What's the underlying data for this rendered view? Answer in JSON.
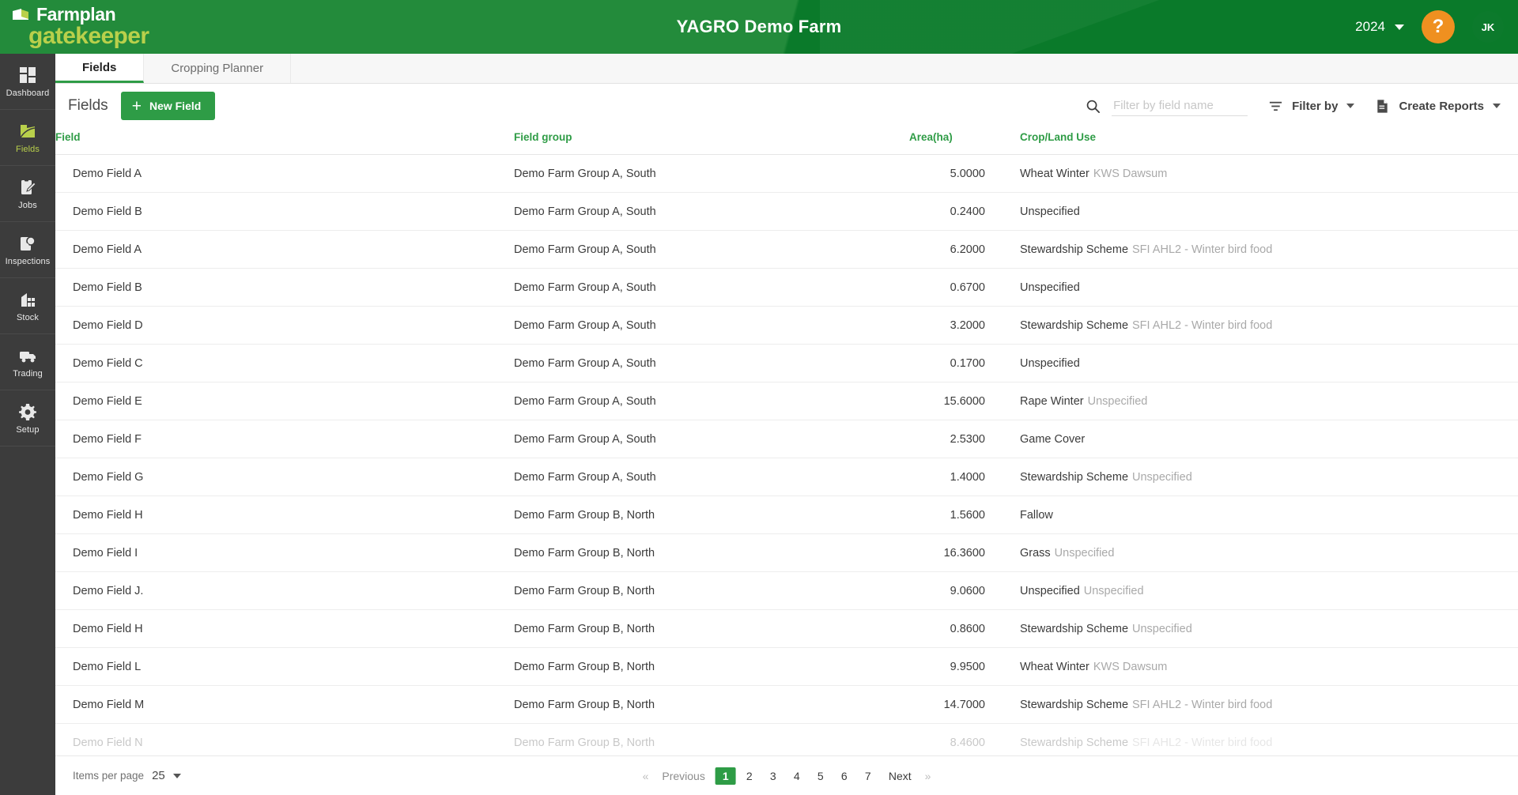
{
  "header": {
    "logo_primary": "Farmplan",
    "logo_secondary": "gatekeeper",
    "logo_mark_icon": "farmplan-leaf-icon",
    "farm_title": "YAGRO Demo Farm",
    "year": "2024",
    "year_caret_icon": "chevron-down-icon",
    "help_label": "?",
    "avatar_initials": "JK",
    "accent_green": "#1f8b38",
    "accent_orange": "#ef9020",
    "accent_lime": "#b9d04b"
  },
  "sidebar": {
    "items": [
      {
        "label": "Dashboard",
        "icon": "dashboard-grid-icon",
        "active": false
      },
      {
        "label": "Fields",
        "icon": "field-landscape-icon",
        "active": true
      },
      {
        "label": "Jobs",
        "icon": "clipboard-pencil-icon",
        "active": false
      },
      {
        "label": "Inspections",
        "icon": "magnifier-clipboard-icon",
        "active": false
      },
      {
        "label": "Stock",
        "icon": "warehouse-icon",
        "active": false
      },
      {
        "label": "Trading",
        "icon": "truck-icon",
        "active": false
      },
      {
        "label": "Setup",
        "icon": "gear-icon",
        "active": false
      }
    ]
  },
  "tabs": [
    {
      "label": "Fields",
      "active": true
    },
    {
      "label": "Cropping Planner",
      "active": false
    }
  ],
  "toolbar": {
    "page_title": "Fields",
    "new_field_label": "New Field",
    "new_field_plus": "+",
    "search_placeholder": "Filter by field name",
    "search_value": "",
    "search_icon": "search-icon",
    "filter_by_label": "Filter by",
    "filter_icon": "filter-funnel-icon",
    "create_reports_label": "Create Reports",
    "create_reports_icon": "document-icon"
  },
  "table": {
    "columns": [
      "Field",
      "Field group",
      "Area(ha)",
      "Crop/Land Use"
    ],
    "rows": [
      {
        "field": "Demo Field A",
        "group": "Demo Farm Group A, South",
        "area": "5.0000",
        "crop": "Wheat Winter",
        "variety": "KWS Dawsum"
      },
      {
        "field": "Demo Field B",
        "group": "Demo Farm Group A, South",
        "area": "0.2400",
        "crop": "Unspecified",
        "variety": ""
      },
      {
        "field": "Demo Field A",
        "group": "Demo Farm Group A, South",
        "area": "6.2000",
        "crop": "Stewardship Scheme",
        "variety": "SFI AHL2 - Winter bird food"
      },
      {
        "field": "Demo Field B",
        "group": "Demo Farm Group A, South",
        "area": "0.6700",
        "crop": "Unspecified",
        "variety": ""
      },
      {
        "field": "Demo Field D",
        "group": "Demo Farm Group A, South",
        "area": "3.2000",
        "crop": "Stewardship Scheme",
        "variety": "SFI AHL2 - Winter bird food"
      },
      {
        "field": "Demo Field C",
        "group": "Demo Farm Group A, South",
        "area": "0.1700",
        "crop": "Unspecified",
        "variety": ""
      },
      {
        "field": "Demo Field E",
        "group": "Demo Farm Group A, South",
        "area": "15.6000",
        "crop": "Rape Winter",
        "variety": "Unspecified"
      },
      {
        "field": "Demo Field F",
        "group": "Demo Farm Group A, South",
        "area": "2.5300",
        "crop": "Game Cover",
        "variety": ""
      },
      {
        "field": "Demo Field G",
        "group": "Demo Farm Group A, South",
        "area": "1.4000",
        "crop": "Stewardship Scheme",
        "variety": "Unspecified"
      },
      {
        "field": "Demo Field H",
        "group": "Demo Farm Group B, North",
        "area": "1.5600",
        "crop": "Fallow",
        "variety": ""
      },
      {
        "field": "Demo Field I",
        "group": "Demo Farm Group B, North",
        "area": "16.3600",
        "crop": "Grass",
        "variety": "Unspecified"
      },
      {
        "field": "Demo Field J.",
        "group": "Demo Farm Group B, North",
        "area": "9.0600",
        "crop": "Unspecified",
        "variety": "Unspecified"
      },
      {
        "field": "Demo Field H",
        "group": "Demo Farm Group B, North",
        "area": "0.8600",
        "crop": "Stewardship Scheme",
        "variety": "Unspecified"
      },
      {
        "field": "Demo Field L",
        "group": "Demo Farm Group B, North",
        "area": "9.9500",
        "crop": "Wheat Winter",
        "variety": "KWS Dawsum"
      },
      {
        "field": "Demo Field M",
        "group": "Demo Farm Group B, North",
        "area": "14.7000",
        "crop": "Stewardship Scheme",
        "variety": "SFI AHL2 - Winter bird food"
      },
      {
        "field": "Demo Field N",
        "group": "Demo Farm Group B, North",
        "area": "8.4600",
        "crop": "Stewardship Scheme",
        "variety": "SFI AHL2 - Winter bird food"
      }
    ]
  },
  "pagination": {
    "items_per_page_label": "Items per page",
    "items_per_page_value": "25",
    "items_per_page_caret_icon": "chevron-down-icon",
    "prev_chevron": "«",
    "prev_label": "Previous",
    "pages": [
      "1",
      "2",
      "3",
      "4",
      "5",
      "6",
      "7"
    ],
    "active_page": "1",
    "next_label": "Next",
    "next_chevron": "»"
  }
}
